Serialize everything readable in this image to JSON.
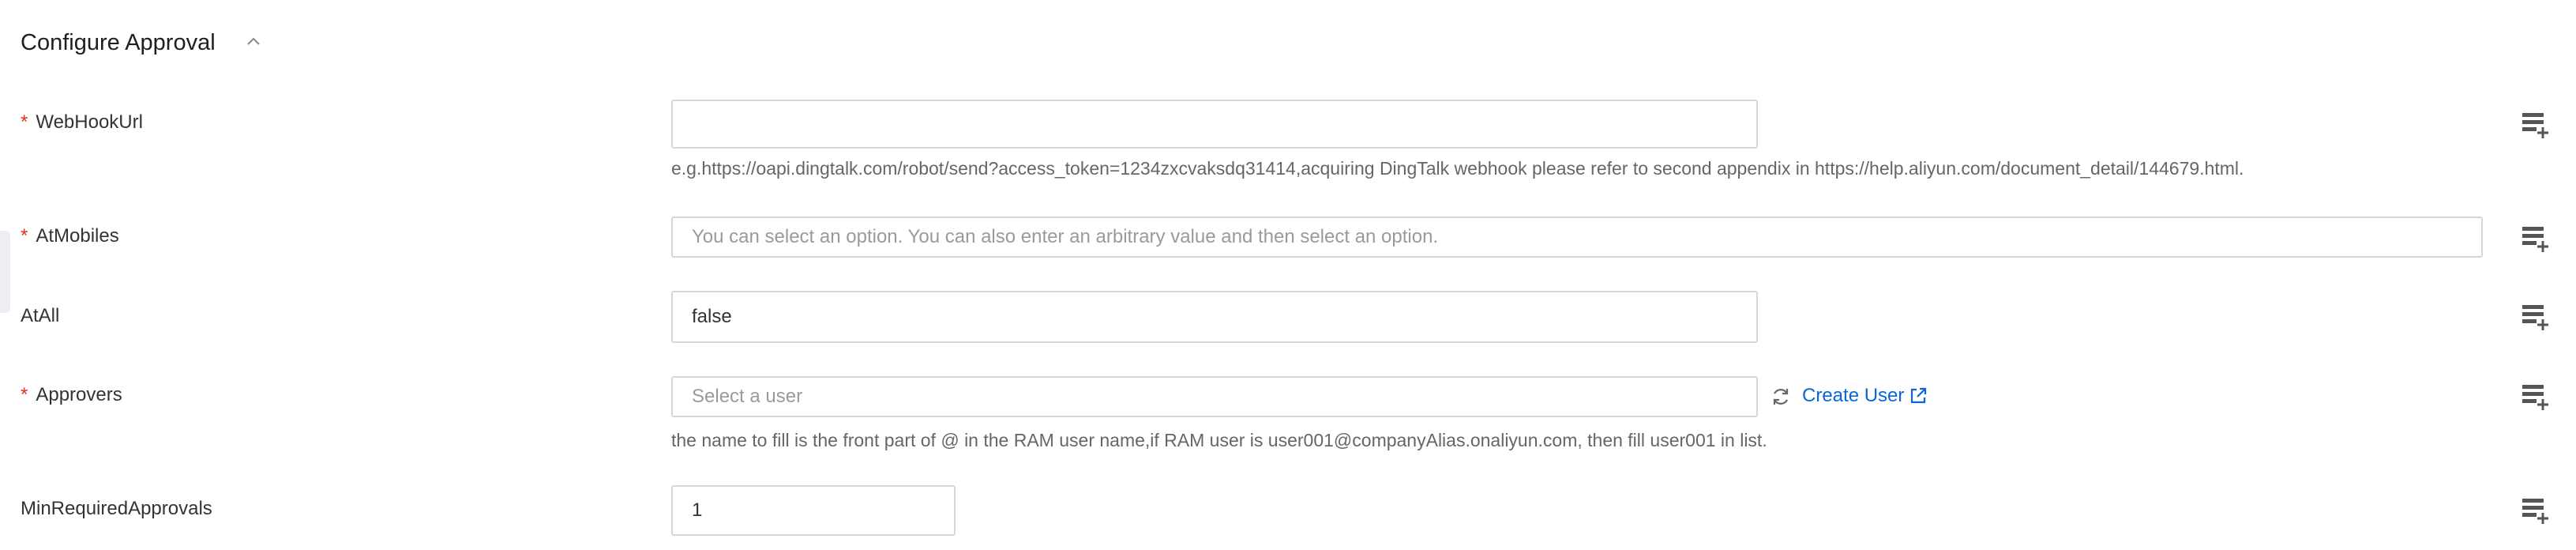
{
  "section": {
    "title": "Configure Approval"
  },
  "fields": {
    "webhook": {
      "label": "WebHookUrl",
      "required_mark": "*",
      "value": "",
      "help": "e.g.https://oapi.dingtalk.com/robot/send?access_token=1234zxcvaksdq31414,acquiring DingTalk webhook please refer to second appendix in https://help.aliyun.com/document_detail/144679.html."
    },
    "atmobiles": {
      "label": "AtMobiles",
      "required_mark": "*",
      "placeholder": "You can select an option. You can also enter an arbitrary value and then select an option."
    },
    "atall": {
      "label": "AtAll",
      "value": "false"
    },
    "approvers": {
      "label": "Approvers",
      "required_mark": "*",
      "placeholder": "Select a user",
      "create_user_label": "Create User",
      "help": "the name to fill is the front part of @ in the RAM user name,if RAM user is user001@companyAlias.onaliyun.com, then fill user001 in list."
    },
    "minapprovals": {
      "label": "MinRequiredApprovals",
      "value": "1"
    }
  },
  "icons": {
    "collapse": "chevron-up-icon",
    "list_toggle": "list-add-icon",
    "refresh": "refresh-icon",
    "external": "external-link-icon"
  },
  "colors": {
    "required": "#e0301e",
    "link": "#0a66d6",
    "border": "#d6d6d6"
  }
}
